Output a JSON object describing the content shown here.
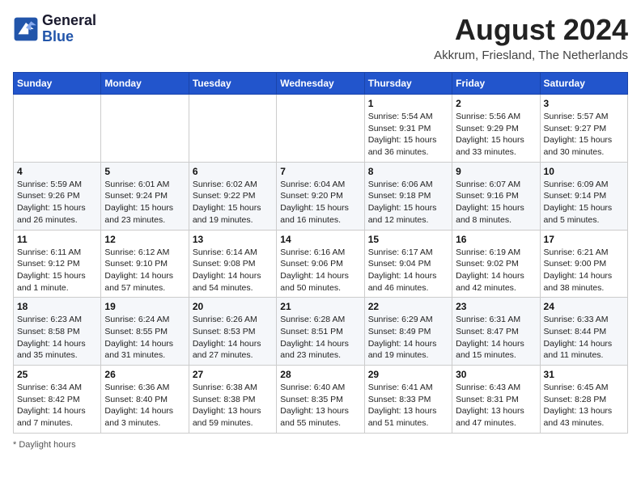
{
  "header": {
    "logo_line1": "General",
    "logo_line2": "Blue",
    "month_year": "August 2024",
    "location": "Akkrum, Friesland, The Netherlands"
  },
  "days_of_week": [
    "Sunday",
    "Monday",
    "Tuesday",
    "Wednesday",
    "Thursday",
    "Friday",
    "Saturday"
  ],
  "weeks": [
    [
      {
        "day": "",
        "info": ""
      },
      {
        "day": "",
        "info": ""
      },
      {
        "day": "",
        "info": ""
      },
      {
        "day": "",
        "info": ""
      },
      {
        "day": "1",
        "info": "Sunrise: 5:54 AM\nSunset: 9:31 PM\nDaylight: 15 hours and 36 minutes."
      },
      {
        "day": "2",
        "info": "Sunrise: 5:56 AM\nSunset: 9:29 PM\nDaylight: 15 hours and 33 minutes."
      },
      {
        "day": "3",
        "info": "Sunrise: 5:57 AM\nSunset: 9:27 PM\nDaylight: 15 hours and 30 minutes."
      }
    ],
    [
      {
        "day": "4",
        "info": "Sunrise: 5:59 AM\nSunset: 9:26 PM\nDaylight: 15 hours and 26 minutes."
      },
      {
        "day": "5",
        "info": "Sunrise: 6:01 AM\nSunset: 9:24 PM\nDaylight: 15 hours and 23 minutes."
      },
      {
        "day": "6",
        "info": "Sunrise: 6:02 AM\nSunset: 9:22 PM\nDaylight: 15 hours and 19 minutes."
      },
      {
        "day": "7",
        "info": "Sunrise: 6:04 AM\nSunset: 9:20 PM\nDaylight: 15 hours and 16 minutes."
      },
      {
        "day": "8",
        "info": "Sunrise: 6:06 AM\nSunset: 9:18 PM\nDaylight: 15 hours and 12 minutes."
      },
      {
        "day": "9",
        "info": "Sunrise: 6:07 AM\nSunset: 9:16 PM\nDaylight: 15 hours and 8 minutes."
      },
      {
        "day": "10",
        "info": "Sunrise: 6:09 AM\nSunset: 9:14 PM\nDaylight: 15 hours and 5 minutes."
      }
    ],
    [
      {
        "day": "11",
        "info": "Sunrise: 6:11 AM\nSunset: 9:12 PM\nDaylight: 15 hours and 1 minute."
      },
      {
        "day": "12",
        "info": "Sunrise: 6:12 AM\nSunset: 9:10 PM\nDaylight: 14 hours and 57 minutes."
      },
      {
        "day": "13",
        "info": "Sunrise: 6:14 AM\nSunset: 9:08 PM\nDaylight: 14 hours and 54 minutes."
      },
      {
        "day": "14",
        "info": "Sunrise: 6:16 AM\nSunset: 9:06 PM\nDaylight: 14 hours and 50 minutes."
      },
      {
        "day": "15",
        "info": "Sunrise: 6:17 AM\nSunset: 9:04 PM\nDaylight: 14 hours and 46 minutes."
      },
      {
        "day": "16",
        "info": "Sunrise: 6:19 AM\nSunset: 9:02 PM\nDaylight: 14 hours and 42 minutes."
      },
      {
        "day": "17",
        "info": "Sunrise: 6:21 AM\nSunset: 9:00 PM\nDaylight: 14 hours and 38 minutes."
      }
    ],
    [
      {
        "day": "18",
        "info": "Sunrise: 6:23 AM\nSunset: 8:58 PM\nDaylight: 14 hours and 35 minutes."
      },
      {
        "day": "19",
        "info": "Sunrise: 6:24 AM\nSunset: 8:55 PM\nDaylight: 14 hours and 31 minutes."
      },
      {
        "day": "20",
        "info": "Sunrise: 6:26 AM\nSunset: 8:53 PM\nDaylight: 14 hours and 27 minutes."
      },
      {
        "day": "21",
        "info": "Sunrise: 6:28 AM\nSunset: 8:51 PM\nDaylight: 14 hours and 23 minutes."
      },
      {
        "day": "22",
        "info": "Sunrise: 6:29 AM\nSunset: 8:49 PM\nDaylight: 14 hours and 19 minutes."
      },
      {
        "day": "23",
        "info": "Sunrise: 6:31 AM\nSunset: 8:47 PM\nDaylight: 14 hours and 15 minutes."
      },
      {
        "day": "24",
        "info": "Sunrise: 6:33 AM\nSunset: 8:44 PM\nDaylight: 14 hours and 11 minutes."
      }
    ],
    [
      {
        "day": "25",
        "info": "Sunrise: 6:34 AM\nSunset: 8:42 PM\nDaylight: 14 hours and 7 minutes."
      },
      {
        "day": "26",
        "info": "Sunrise: 6:36 AM\nSunset: 8:40 PM\nDaylight: 14 hours and 3 minutes."
      },
      {
        "day": "27",
        "info": "Sunrise: 6:38 AM\nSunset: 8:38 PM\nDaylight: 13 hours and 59 minutes."
      },
      {
        "day": "28",
        "info": "Sunrise: 6:40 AM\nSunset: 8:35 PM\nDaylight: 13 hours and 55 minutes."
      },
      {
        "day": "29",
        "info": "Sunrise: 6:41 AM\nSunset: 8:33 PM\nDaylight: 13 hours and 51 minutes."
      },
      {
        "day": "30",
        "info": "Sunrise: 6:43 AM\nSunset: 8:31 PM\nDaylight: 13 hours and 47 minutes."
      },
      {
        "day": "31",
        "info": "Sunrise: 6:45 AM\nSunset: 8:28 PM\nDaylight: 13 hours and 43 minutes."
      }
    ]
  ],
  "footer": {
    "note": "Daylight hours"
  }
}
